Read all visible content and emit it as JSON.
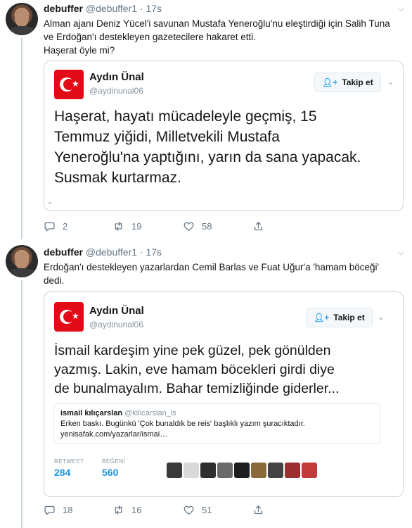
{
  "tweets": [
    {
      "name": "debuffer",
      "handle": "@debuffer1",
      "dot": "·",
      "time": "17s",
      "text_line1": "Alman ajanı Deniz Yücel'i savunan Mustafa Yeneroğlu'nu eleştirdiği için Salih Tuna",
      "text_line2": "ve Erdoğan'ı destekleyen gazetecilere hakaret etti.",
      "text_line3": "Haşerat öyle mi?",
      "card": {
        "name": "Aydın Ünal",
        "handle": "@aydinunal06",
        "follow_label": "Takip et",
        "body_line1": "Haşerat, hayatı mücadeleyle geçmiş, 15",
        "body_line2": "Temmuz yiğidi, Milletvekili Mustafa",
        "body_line3": "Yeneroğlu'na yaptığını, yarın da sana yapacak.",
        "body_line4": "Susmak kurtarmaz.",
        "mark": "-"
      },
      "replies": "2",
      "retweets": "19",
      "likes": "58"
    },
    {
      "name": "debuffer",
      "handle": "@debuffer1",
      "dot": "·",
      "time": "17s",
      "text_line1": "Erdoğan'ı destekleyen yazarlardan Cemil Barlas ve Fuat Uğur'a 'hamam böceği'",
      "text_line2": "dedi.",
      "card": {
        "name": "Aydın Ünal",
        "handle": "@aydinunal06",
        "follow_label": "Takip et",
        "body_line1": "İsmail kardeşim yine pek güzel, pek gönülden",
        "body_line2": "yazmış. Lakin, eve hamam böcekleri girdi diye",
        "body_line3": "de bunalmayalım. Bahar temizliğinde giderler...",
        "quote": {
          "name": "ismail kılıçarslan",
          "handle": "@kilicarslan_is",
          "line1": "Erken baskı. Bugünkü 'Çok bunaldık be reis' başlıklı yazım şuracıktadır.",
          "line2": "yenisafak.com/yazarlar/ismai…"
        },
        "retweet_label": "RETWEET",
        "retweet_count": "284",
        "like_label": "BEĞENİ",
        "like_count": "560"
      },
      "replies": "18",
      "retweets": "16",
      "likes": "51"
    }
  ],
  "icons": {
    "reply": "reply-icon",
    "retweet": "retweet-icon",
    "like": "heart-icon",
    "share": "share-icon",
    "follow": "add-user-icon",
    "caret": "chevron-down-icon"
  },
  "colors": {
    "accent": "#1da1f2",
    "flag_red": "#e30a17",
    "muted": "#657786"
  }
}
